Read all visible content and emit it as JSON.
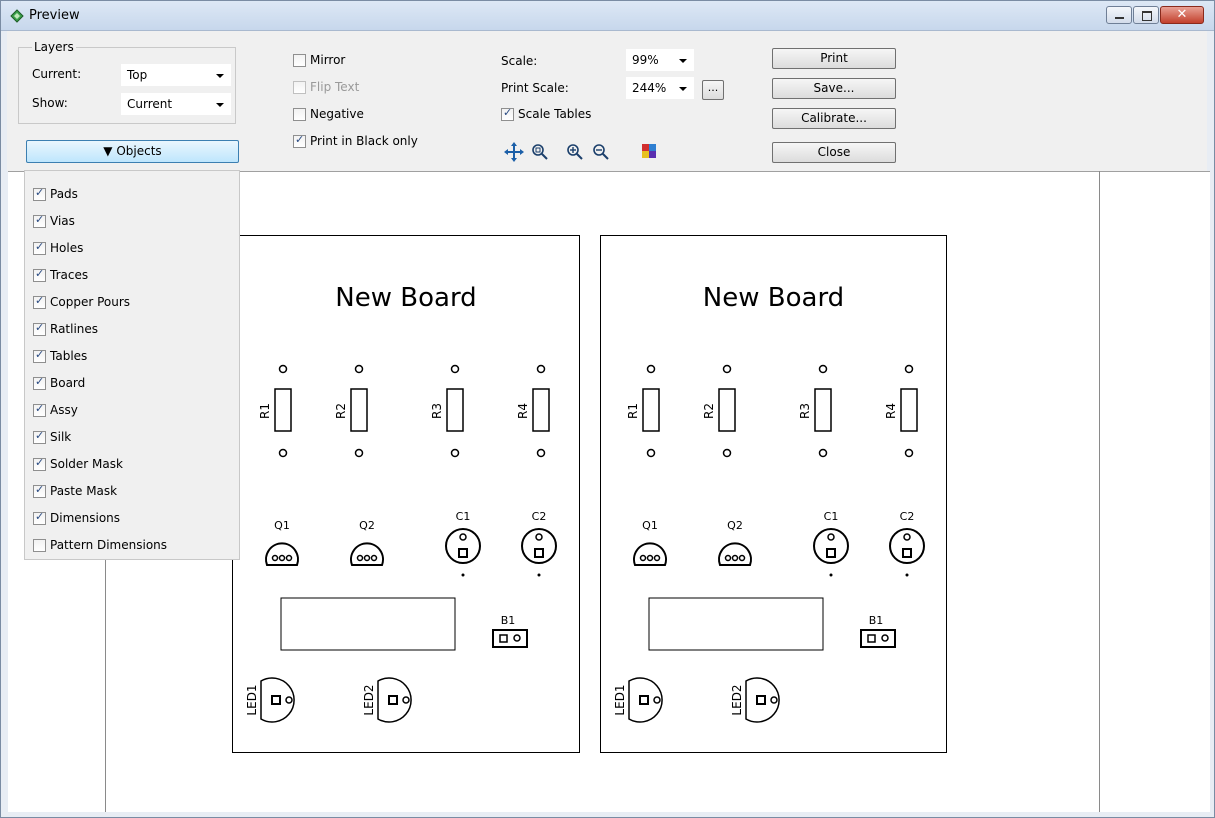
{
  "window": {
    "title": "Preview"
  },
  "layers": {
    "legend": "Layers",
    "current_label": "Current:",
    "current_value": "Top",
    "show_label": "Show:",
    "show_value": "Current"
  },
  "options": {
    "mirror": "Mirror",
    "flip_text": "Flip Text",
    "negative": "Negative",
    "print_black": "Print in Black only"
  },
  "scale": {
    "scale_label": "Scale:",
    "scale_value": "99%",
    "print_scale_label": "Print Scale:",
    "print_scale_value": "244%",
    "ellipsis": "...",
    "scale_tables": "Scale Tables"
  },
  "buttons": {
    "print": "Print",
    "save": "Save...",
    "calibrate": "Calibrate...",
    "close": "Close"
  },
  "objects": {
    "toggle_label": "▼ Objects",
    "items": [
      {
        "label": "Pads",
        "checked": true
      },
      {
        "label": "Vias",
        "checked": true
      },
      {
        "label": "Holes",
        "checked": true
      },
      {
        "label": "Traces",
        "checked": true
      },
      {
        "label": "Copper Pours",
        "checked": true
      },
      {
        "label": "Ratlines",
        "checked": true
      },
      {
        "label": "Tables",
        "checked": true
      },
      {
        "label": "Board",
        "checked": true
      },
      {
        "label": "Assy",
        "checked": true
      },
      {
        "label": "Silk",
        "checked": true
      },
      {
        "label": "Solder Mask",
        "checked": true
      },
      {
        "label": "Paste Mask",
        "checked": true
      },
      {
        "label": "Dimensions",
        "checked": true
      },
      {
        "label": "Pattern Dimensions",
        "checked": false
      }
    ]
  },
  "board": {
    "title": "New Board",
    "resistors": [
      "R1",
      "R2",
      "R3",
      "R4"
    ],
    "transistors": [
      "Q1",
      "Q2"
    ],
    "capacitors": [
      "C1",
      "C2"
    ],
    "battery": "B1",
    "leds": [
      "LED1",
      "LED2"
    ]
  }
}
